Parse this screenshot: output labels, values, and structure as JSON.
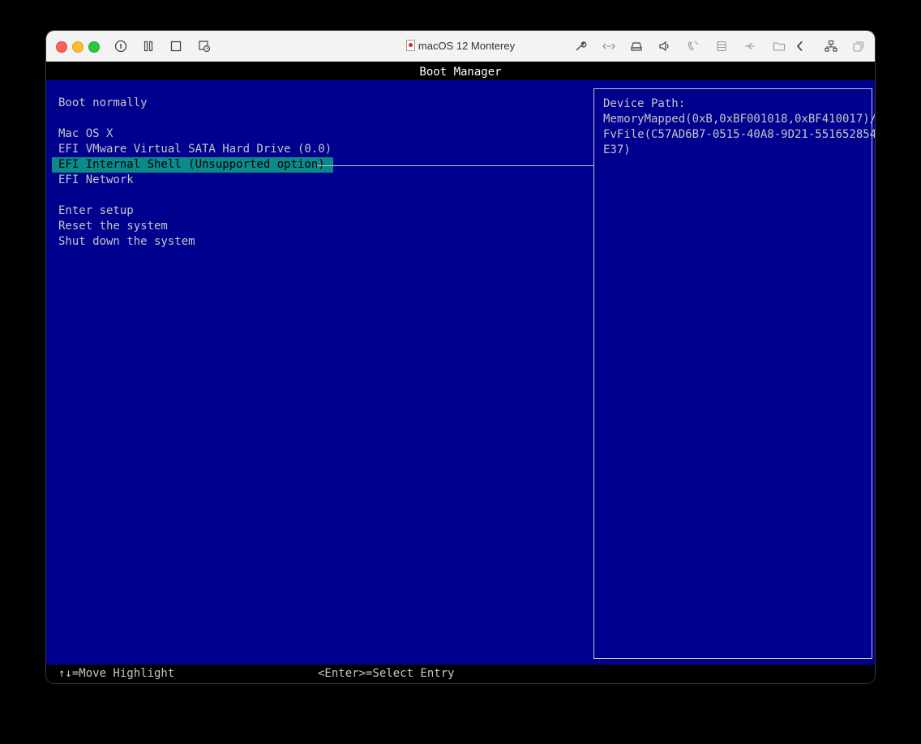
{
  "window": {
    "title": "macOS 12 Monterey",
    "toolbar_icons": [
      "info-icon",
      "pause-icon",
      "stop-icon",
      "snapshot-icon",
      "settings-wrench-icon",
      "network-arrows-icon",
      "disk-drive-icon",
      "speaker-icon",
      "camera-icon",
      "storage-icon",
      "usb-icon",
      "shared-folder-icon",
      "back-chevron-icon",
      "network-devices-icon",
      "fullscreen-icon"
    ]
  },
  "bios": {
    "header": "Boot Manager",
    "menu": [
      {
        "label": "Boot normally",
        "selected": false
      },
      {
        "label": "Mac OS X",
        "selected": false
      },
      {
        "label": "EFI VMware Virtual SATA Hard Drive (0.0)",
        "selected": false
      },
      {
        "label": "EFI Internal Shell (Unsupported option)",
        "selected": true
      },
      {
        "label": "EFI Network",
        "selected": false
      },
      {
        "label": "Enter setup",
        "selected": false
      },
      {
        "label": "Reset the system",
        "selected": false
      },
      {
        "label": "Shut down the system",
        "selected": false
      }
    ],
    "info": {
      "lines": [
        "Device Path:",
        "MemoryMapped(0xB,0xBF001018,0xBF410017)/",
        "FvFile(C57AD6B7-0515-40A8-9D21-551652854",
        "E37)"
      ]
    },
    "footer": {
      "move_hint": "↑↓=Move Highlight",
      "select_hint": "<Enter>=Select Entry"
    }
  },
  "colors": {
    "bios_background": "#00008f",
    "selection": "#0a8a8a",
    "text": "#c6c6c6"
  }
}
